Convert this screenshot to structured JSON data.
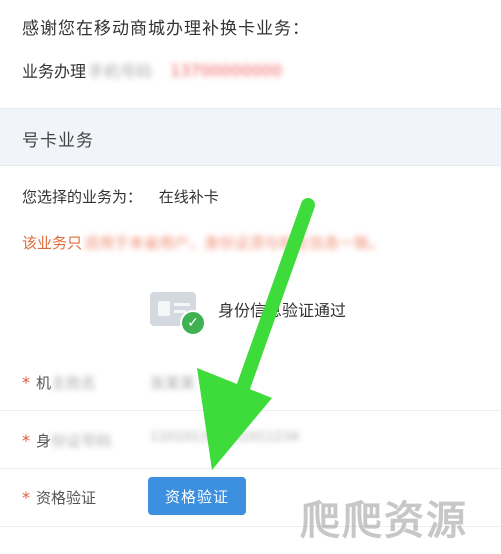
{
  "header": {
    "thanks_text": "感谢您在移动商城办理补换卡业务：",
    "handler_label": "业务办理",
    "handler_blur_gray": "手机号码",
    "handler_blur_red": "13700000000"
  },
  "section": {
    "title": "号卡业务"
  },
  "selected": {
    "label": "您选择的业务为：",
    "value": "在线补卡"
  },
  "warning": {
    "visible": "该业务只",
    "blurred": "适用于本省用户，身份证须与机主信息一致。"
  },
  "verify": {
    "status_text": "身份信息验证通过",
    "check_mark": "✓"
  },
  "fields": [
    {
      "required_mark": "*",
      "label_visible": "机",
      "label_blurred": "主姓名",
      "value_blurred": "张某某"
    },
    {
      "required_mark": "*",
      "label_visible": "身",
      "label_blurred": "份证号码",
      "value_blurred": "110101199001011234"
    },
    {
      "required_mark": "*",
      "label_visible": "资格验证",
      "label_blurred": "",
      "value_blurred": ""
    }
  ],
  "button": {
    "label": "资格验证"
  },
  "watermark": {
    "text": "爬爬资源"
  },
  "colors": {
    "accent_blue": "#3d8fe0",
    "warning_orange": "#e06b3a",
    "success_green": "#3fb153",
    "arrow_green": "#3ddc3a"
  }
}
